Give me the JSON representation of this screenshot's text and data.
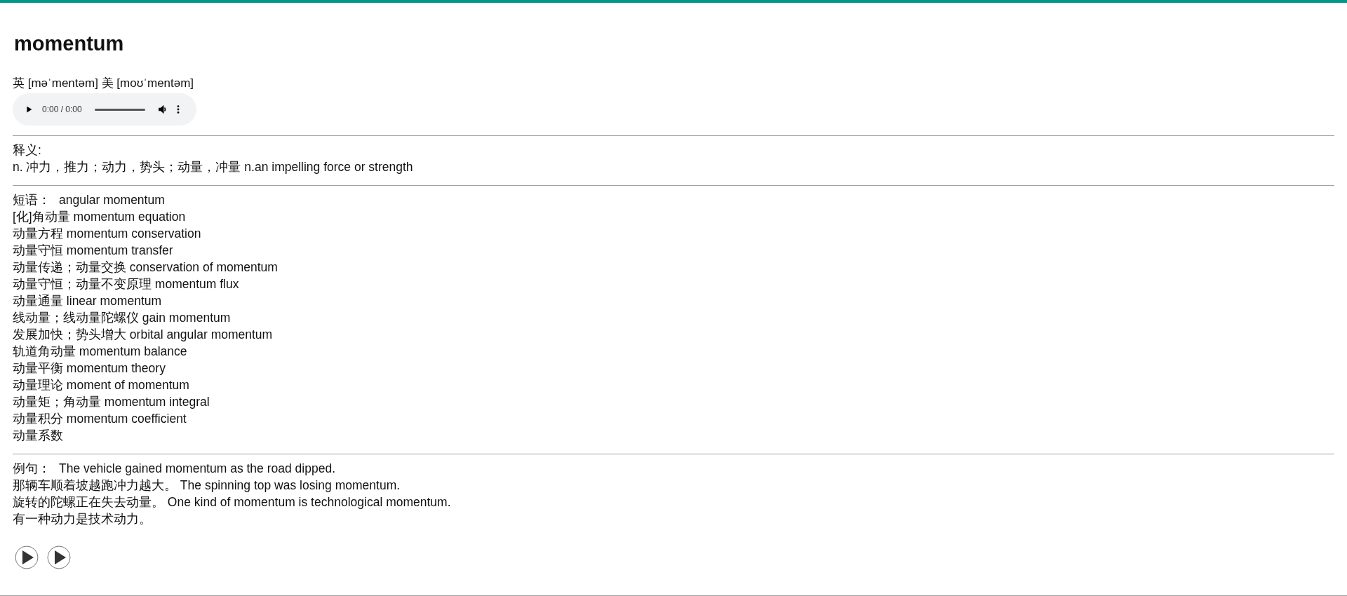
{
  "word": "momentum",
  "pronunciation": "英 [məˈmentəm] 美 [moʊˈmentəm]",
  "audio_player": {
    "time": "0:00 / 0:00",
    "level": 0
  },
  "definition": {
    "label": "释义:",
    "text": "n. 冲力，推力；动力，势头；动量，冲量 n.an impelling force or strength"
  },
  "phrases": {
    "label": "短语：",
    "lines": [
      "angular momentum",
      "[化]角动量 momentum equation",
      "动量方程 momentum conservation",
      "动量守恒 momentum transfer",
      "动量传递；动量交换 conservation of momentum",
      "动量守恒；动量不变原理 momentum flux",
      "动量通量 linear momentum",
      "线动量；线动量陀螺仪 gain momentum",
      "发展加快；势头增大 orbital angular momentum",
      "轨道角动量 momentum balance",
      "动量平衡 momentum theory",
      "动量理论 moment of momentum",
      "动量矩；角动量 momentum integral",
      "动量积分 momentum coefficient",
      "动量系数"
    ]
  },
  "examples": {
    "label": "例句：",
    "lines": [
      "The vehicle gained momentum as the road dipped.",
      "那辆车顺着坡越跑冲力越大。 The spinning top was losing momentum.",
      "旋转的陀螺正在失去动量。 One kind of momentum is technological momentum.",
      "有一种动力是技术动力。"
    ]
  },
  "play_buttons": [
    {
      "kind": "play"
    },
    {
      "kind": "play"
    }
  ]
}
